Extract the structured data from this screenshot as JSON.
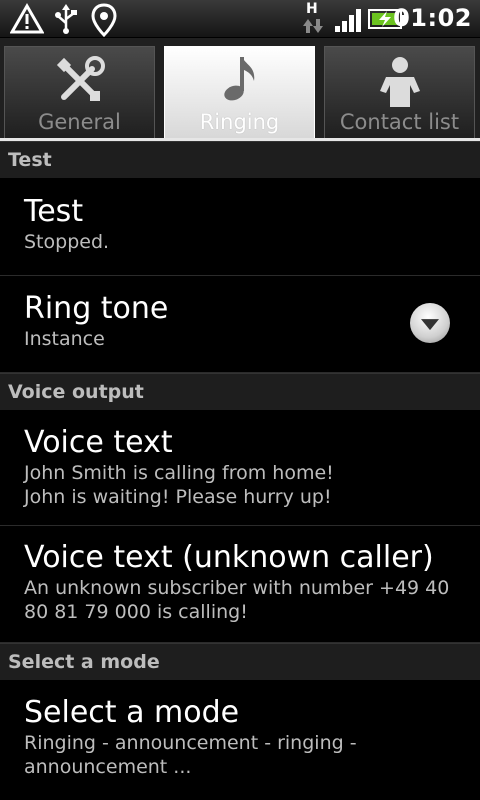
{
  "status_bar": {
    "time": "01:02",
    "network_type": "H",
    "icons": [
      "warning-icon",
      "usb-icon",
      "location-icon",
      "data-transfer-icon",
      "signal-icon",
      "battery-charging-icon"
    ]
  },
  "tabs": [
    {
      "label": "General",
      "icon": "tools-icon",
      "active": false
    },
    {
      "label": "Ringing",
      "icon": "music-note-icon",
      "active": true
    },
    {
      "label": "Contact list",
      "icon": "person-icon",
      "active": false
    }
  ],
  "sections": {
    "test": {
      "header": "Test",
      "test_item": {
        "title": "Test",
        "summary": "Stopped."
      },
      "ring_tone": {
        "title": "Ring tone",
        "summary": "Instance"
      }
    },
    "voice_output": {
      "header": "Voice output",
      "voice_text": {
        "title": "Voice text",
        "summary_line1": "John Smith is calling from home!",
        "summary_line2": "John is waiting! Please hurry up!"
      },
      "voice_text_unknown": {
        "title": "Voice text (unknown caller)",
        "summary_line1": "An unknown subscriber with number +49 40",
        "summary_line2": "80 81 79 000 is calling!"
      }
    },
    "select_mode": {
      "header": "Select a mode",
      "mode_item": {
        "title": "Select a mode",
        "summary_line1": "Ringing - announcement - ringing -",
        "summary_line2": "announcement ..."
      }
    }
  },
  "colors": {
    "accent_tab": "#ffffff",
    "background": "#000000",
    "category_bg": "#1e1e1e"
  }
}
